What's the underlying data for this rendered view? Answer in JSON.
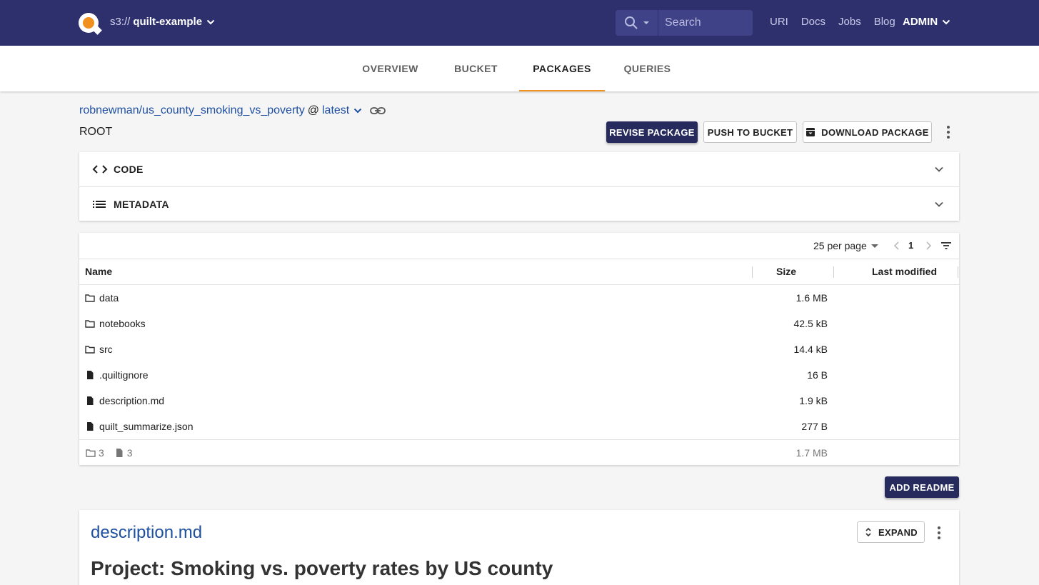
{
  "header": {
    "bucket_scheme": "s3://",
    "bucket_name": "quilt-example",
    "search_placeholder": "Search",
    "links": [
      "URI",
      "Docs",
      "Jobs",
      "Blog"
    ],
    "user": "ADMIN"
  },
  "tabs": [
    "OVERVIEW",
    "BUCKET",
    "PACKAGES",
    "QUERIES"
  ],
  "active_tab": "PACKAGES",
  "package": {
    "name": "robnewman/us_county_smoking_vs_poverty",
    "at": "@",
    "revision": "latest",
    "path": "ROOT"
  },
  "actions": {
    "revise": "REVISE PACKAGE",
    "push": "PUSH TO BUCKET",
    "download": "DOWNLOAD PACKAGE"
  },
  "accordions": {
    "code": "CODE",
    "metadata": "METADATA"
  },
  "table": {
    "per_page": "25 per page",
    "page": "1",
    "columns": {
      "name": "Name",
      "size": "Size",
      "modified": "Last modified"
    },
    "rows": [
      {
        "name": "data",
        "size": "1.6 MB",
        "kind": "folder"
      },
      {
        "name": "notebooks",
        "size": "42.5 kB",
        "kind": "folder"
      },
      {
        "name": "src",
        "size": "14.4 kB",
        "kind": "folder"
      },
      {
        "name": ".quiltignore",
        "size": "16 B",
        "kind": "file"
      },
      {
        "name": "description.md",
        "size": "1.9 kB",
        "kind": "file"
      },
      {
        "name": "quilt_summarize.json",
        "size": "277 B",
        "kind": "file"
      }
    ],
    "footer": {
      "folders": "3",
      "files": "3",
      "total": "1.7 MB"
    }
  },
  "add_readme": "ADD README",
  "readme": {
    "file": "description.md",
    "expand": "EXPAND",
    "heading": "Project: Smoking vs. poverty rates by US county"
  },
  "colors": {
    "header_bg": "#2d306d",
    "accent": "#f0901e",
    "link": "#1f4fa0",
    "button_dark": "#262a5c"
  }
}
